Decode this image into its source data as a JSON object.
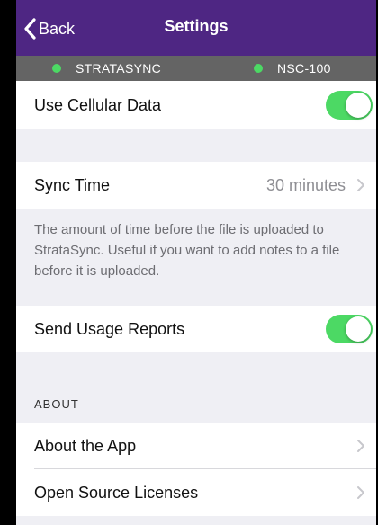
{
  "nav": {
    "back_label": "Back",
    "title": "Settings"
  },
  "status": {
    "devices": [
      {
        "label": "STRATASYNC",
        "status_color": "#4cd964"
      },
      {
        "label": "NSC-100",
        "status_color": "#4cd964"
      }
    ]
  },
  "settings": {
    "cellular": {
      "label": "Use Cellular Data",
      "enabled": true
    },
    "sync_time": {
      "label": "Sync Time",
      "value": "30 minutes"
    },
    "sync_help": "The amount of time before the file is uploaded to StrataSync. Useful if you want to add notes to a file before it is uploaded.",
    "usage_reports": {
      "label": "Send Usage Reports",
      "enabled": true
    }
  },
  "about": {
    "header": "ABOUT",
    "items": [
      {
        "label": "About the App"
      },
      {
        "label": "Open Source Licenses"
      }
    ]
  },
  "colors": {
    "nav_bg": "#4e2683",
    "status_bg": "#646464",
    "toggle_on": "#4cd964",
    "page_bg": "#efeff4"
  },
  "icons": {
    "back": "chevron-left-icon",
    "disclosure": "chevron-right-icon",
    "status": "status-dot-icon"
  }
}
